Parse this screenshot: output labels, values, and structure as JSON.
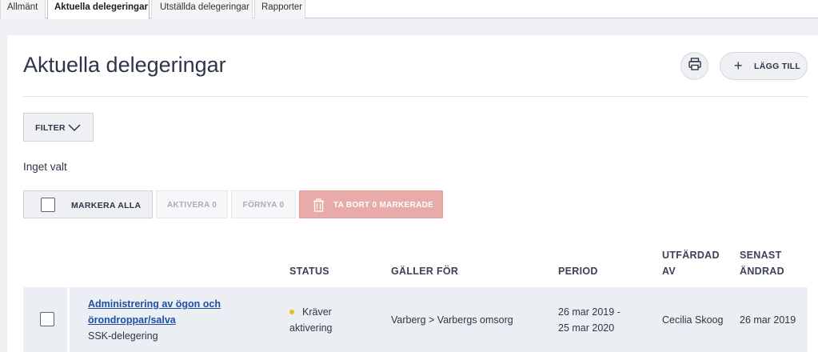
{
  "tabs": [
    {
      "label": "Allmänt",
      "active": false
    },
    {
      "label": "Aktuella delegeringar",
      "active": true
    },
    {
      "label": "Utställda delegeringar",
      "active": false
    },
    {
      "label": "Rapporter",
      "active": false
    }
  ],
  "page": {
    "title": "Aktuella delegeringar",
    "print_icon": "printer-icon",
    "add_label": "LÄGG TILL"
  },
  "filter": {
    "label": "FILTER",
    "selection_text": "Inget valt"
  },
  "actions": {
    "mark_all": "MARKERA ALLA",
    "activate": "AKTIVERA 0",
    "renew": "FÖRNYA 0",
    "delete": "TA BORT 0 MARKERADE"
  },
  "table": {
    "headers": {
      "status": "STATUS",
      "applies_to": "GÄLLER FÖR",
      "period": "PERIOD",
      "issued_by_1": "UTFÄRDAD",
      "issued_by_2": "AV",
      "last_changed_1": "SENAST",
      "last_changed_2": "ÄNDRAD"
    },
    "rows": [
      {
        "title_1": "Administrering av ögon och",
        "title_2": "örondroppar/salva",
        "subtitle": "SSK-delegering",
        "status_1": "Kräver",
        "status_2": "aktivering",
        "applies_to": "Varberg > Varbergs omsorg",
        "period_1": "26 mar 2019 -",
        "period_2": "25 mar 2020",
        "issued_by": "Cecilia Skoog",
        "last_changed": "26 mar 2019"
      }
    ]
  },
  "colors": {
    "accent_link": "#1f4fa5",
    "delete_bg": "#e9aaaa",
    "status_dot": "#e1c122"
  }
}
